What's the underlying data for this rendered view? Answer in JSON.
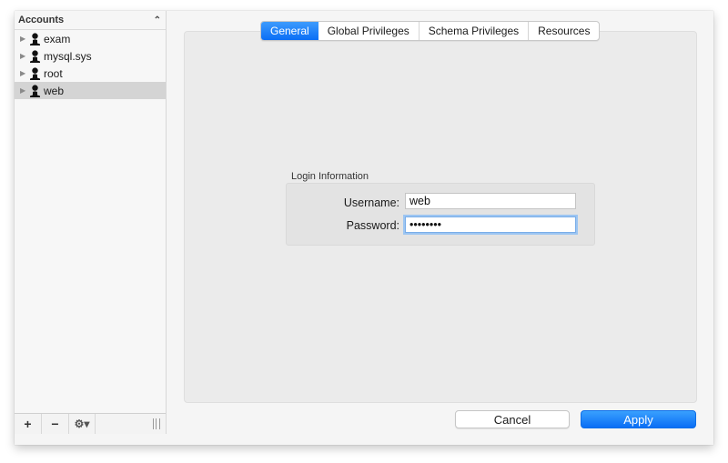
{
  "sidebar": {
    "header": "Accounts",
    "sort_icon": "chevron-up-icon",
    "accounts": [
      {
        "name": "exam",
        "selected": false
      },
      {
        "name": "mysql.sys",
        "selected": false
      },
      {
        "name": "root",
        "selected": false
      },
      {
        "name": "web",
        "selected": true
      }
    ],
    "footer": {
      "add_label": "+",
      "remove_label": "−",
      "gear_label": "⚙▾"
    }
  },
  "tabs": [
    {
      "label": "General",
      "active": true
    },
    {
      "label": "Global Privileges",
      "active": false
    },
    {
      "label": "Schema Privileges",
      "active": false
    },
    {
      "label": "Resources",
      "active": false
    }
  ],
  "login": {
    "group_title": "Login Information",
    "username_label": "Username:",
    "username_value": "web",
    "password_label": "Password:",
    "password_value": "••••••••"
  },
  "buttons": {
    "cancel": "Cancel",
    "apply": "Apply"
  },
  "colors": {
    "accent": "#0a6ef5",
    "selection": "#d4d4d4"
  }
}
